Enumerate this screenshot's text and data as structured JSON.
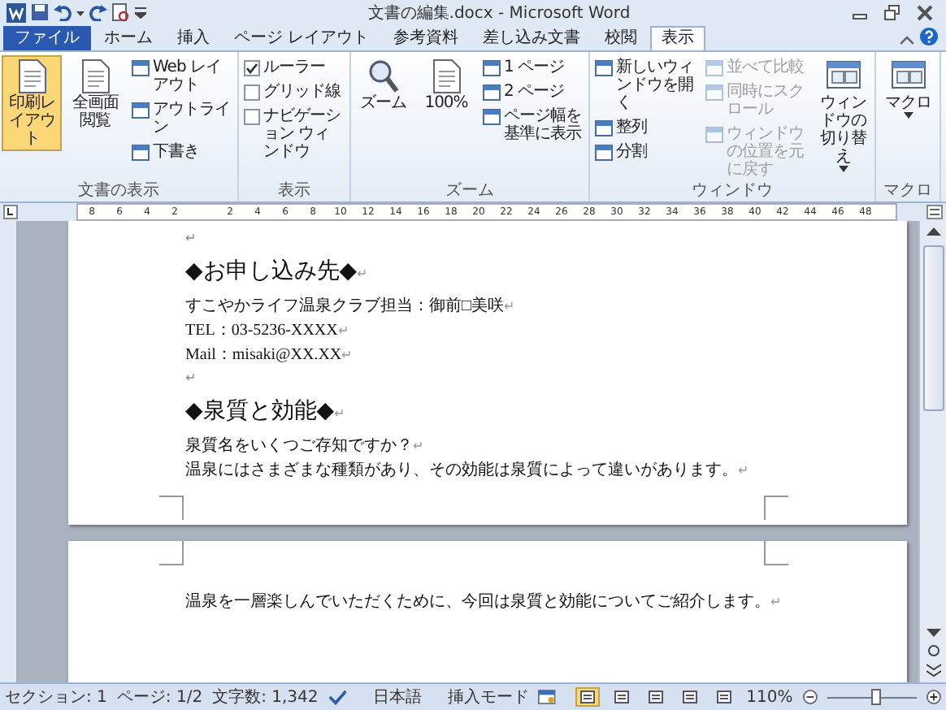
{
  "window": {
    "title": "文書の編集.docx - Microsoft Word"
  },
  "tabs": [
    {
      "label": "ファイル",
      "kind": "file",
      "selected": false
    },
    {
      "label": "ホーム",
      "kind": "tab",
      "selected": false
    },
    {
      "label": "挿入",
      "kind": "tab",
      "selected": false
    },
    {
      "label": "ページ レイアウト",
      "kind": "tab",
      "selected": false
    },
    {
      "label": "参考資料",
      "kind": "tab",
      "selected": false
    },
    {
      "label": "差し込み文書",
      "kind": "tab",
      "selected": false
    },
    {
      "label": "校閲",
      "kind": "tab",
      "selected": false
    },
    {
      "label": "表示",
      "kind": "tab",
      "selected": true
    }
  ],
  "ribbon": {
    "groups": [
      {
        "label": "文書の表示",
        "columns": [
          [
            {
              "label": "印刷レイアウト",
              "kind": "large",
              "selected": true,
              "disabled": false
            }
          ],
          [
            {
              "label": "全画面閲覧",
              "kind": "large",
              "selected": false,
              "disabled": false
            }
          ],
          [
            {
              "label": "Web レイアウト",
              "kind": "small",
              "selected": false,
              "disabled": false
            },
            {
              "label": "アウトライン",
              "kind": "small",
              "selected": false,
              "disabled": false
            },
            {
              "label": "下書き",
              "kind": "small",
              "selected": false,
              "disabled": false
            }
          ]
        ]
      },
      {
        "label": "表示",
        "columns": [
          [
            {
              "label": "ルーラー",
              "kind": "check",
              "checked": true,
              "disabled": false
            },
            {
              "label": "グリッド線",
              "kind": "check",
              "checked": false,
              "disabled": false
            },
            {
              "label": "ナビゲーション ウィンドウ",
              "kind": "check",
              "checked": false,
              "disabled": false
            }
          ]
        ]
      },
      {
        "label": "ズーム",
        "columns": [
          [
            {
              "label": "ズーム",
              "kind": "lens",
              "selected": false,
              "disabled": false
            }
          ],
          [
            {
              "label": "100%",
              "kind": "large",
              "selected": false,
              "disabled": false
            }
          ],
          [
            {
              "label": "1 ページ",
              "kind": "small",
              "selected": false,
              "disabled": false
            },
            {
              "label": "2 ページ",
              "kind": "small",
              "selected": false,
              "disabled": false
            },
            {
              "label": "ページ幅を基準に表示",
              "kind": "small",
              "selected": false,
              "disabled": false
            }
          ]
        ]
      },
      {
        "label": "ウィンドウ",
        "columns": [
          [
            {
              "label": "新しいウィンドウを開く",
              "kind": "small",
              "selected": false,
              "disabled": false
            },
            {
              "label": "整列",
              "kind": "small",
              "selected": false,
              "disabled": false
            },
            {
              "label": "分割",
              "kind": "small",
              "selected": false,
              "disabled": false
            }
          ],
          [
            {
              "label": "並べて比較",
              "kind": "small",
              "selected": false,
              "disabled": true
            },
            {
              "label": "同時にスクロール",
              "kind": "small",
              "selected": false,
              "disabled": true
            },
            {
              "label": "ウィンドウの位置を元に戻す",
              "kind": "small",
              "selected": false,
              "disabled": true
            }
          ],
          [
            {
              "label": "ウィンドウの切り替え",
              "kind": "menu",
              "selected": false,
              "disabled": false
            }
          ]
        ]
      },
      {
        "label": "マクロ",
        "columns": [
          [
            {
              "label": "マクロ",
              "kind": "menu",
              "selected": false,
              "disabled": false
            }
          ]
        ]
      }
    ]
  },
  "ruler": {
    "left_labels": [
      "8",
      "6",
      "4",
      "2"
    ],
    "right_labels": [
      "2",
      "4",
      "6",
      "8",
      "10",
      "12",
      "14",
      "16",
      "18",
      "20",
      "22",
      "24",
      "26",
      "28",
      "30",
      "32",
      "34",
      "36",
      "38",
      "40",
      "42",
      "44",
      "46",
      "48"
    ]
  },
  "pages": [
    {
      "paragraphs": [
        {
          "kind": "empty",
          "mark": "↵"
        },
        {
          "kind": "heading",
          "text": "◆お申し込み先◆",
          "mark": "↵"
        },
        {
          "kind": "body",
          "text": "すこやかライフ温泉クラブ担当：御前□美咲",
          "mark": "↵"
        },
        {
          "kind": "body",
          "text": "TEL：03-5236-XXXX",
          "mark": "↵"
        },
        {
          "kind": "body",
          "text": "Mail：misaki@XX.XX",
          "mark": "↵"
        },
        {
          "kind": "empty",
          "mark": "↵"
        },
        {
          "kind": "heading",
          "text": "◆泉質と効能◆",
          "mark": "↵"
        },
        {
          "kind": "body",
          "text": "泉質名をいくつご存知ですか？",
          "mark": "↵"
        },
        {
          "kind": "body",
          "text": "温泉にはさまざまな種類があり、その効能は泉質によって違いがあります。",
          "mark": "↵"
        }
      ]
    },
    {
      "paragraphs": [
        {
          "kind": "body",
          "text": "温泉を一層楽しんでいただくために、今回は泉質と効能についてご紹介します。",
          "mark": "↵"
        }
      ]
    }
  ],
  "status_bar": {
    "fields": [
      "セクション: 1",
      "ページ: 1/2",
      "文字数: 1,342"
    ],
    "language": "日本語",
    "mode": "挿入モード",
    "views": [
      {
        "selected": true
      },
      {
        "selected": false
      },
      {
        "selected": false
      },
      {
        "selected": false
      },
      {
        "selected": false
      }
    ],
    "zoom": "110%",
    "level": 0.55
  }
}
